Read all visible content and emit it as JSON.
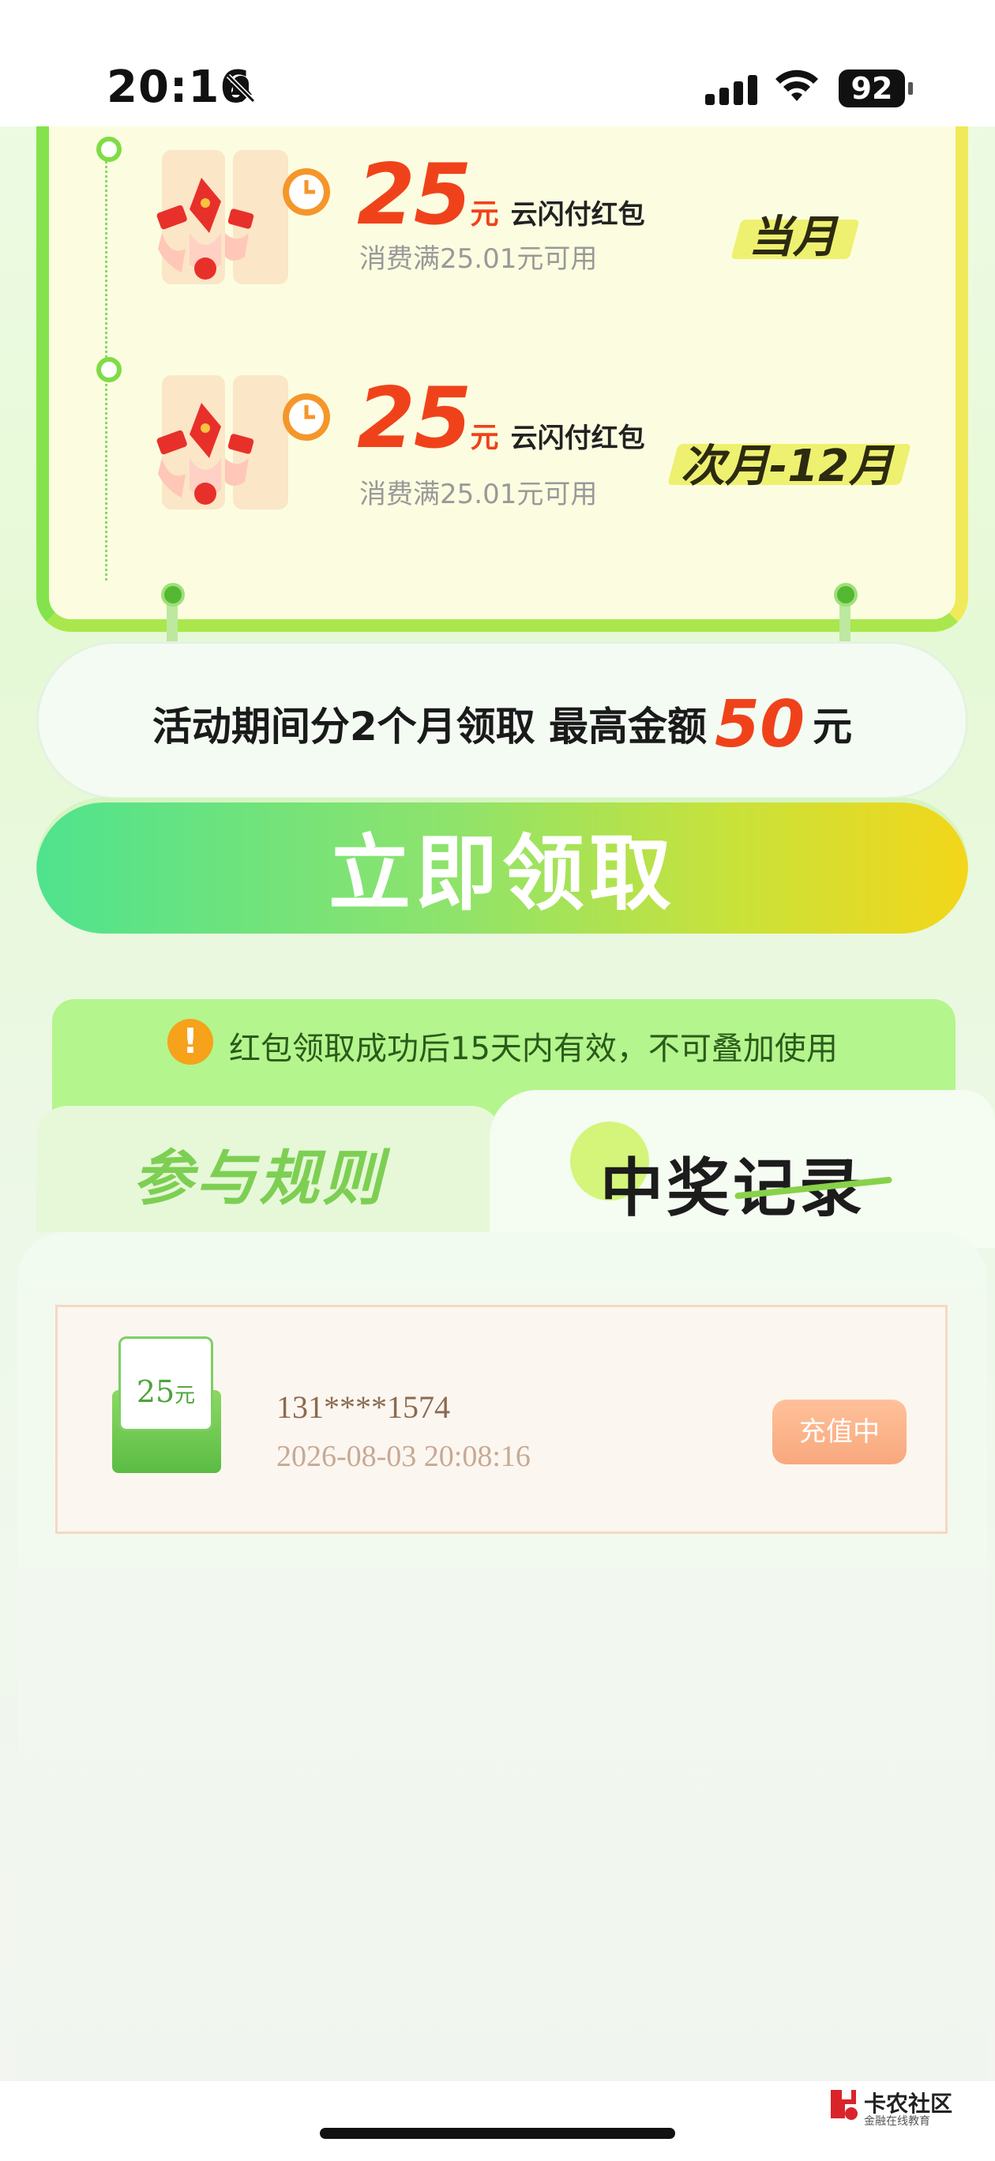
{
  "status_bar": {
    "time": "20:16",
    "battery": "92"
  },
  "coupons": [
    {
      "amount": "25",
      "unit": "元",
      "type": "云闪付红包",
      "condition": "消费满25.01元可用",
      "period": "当月"
    },
    {
      "amount": "25",
      "unit": "元",
      "type": "云闪付红包",
      "condition": "消费满25.01元可用",
      "period": "次月-12月"
    }
  ],
  "banner": {
    "prefix": "活动期间分2个月领取  最高金额",
    "max": "50",
    "suffix": "元"
  },
  "claim_button": "立即领取",
  "notice": {
    "icon": "!",
    "text": "红包领取成功后15天内有效，不可叠加使用"
  },
  "tabs": {
    "rules": "参与规则",
    "records": "中奖记录"
  },
  "records": [
    {
      "ticket_amount": "25",
      "ticket_unit": "元",
      "phone": "131****1574",
      "time": "2026-08-03 20:08:16",
      "status": "充值中"
    }
  ],
  "watermark": {
    "name": "卡农社区",
    "slogan": "金融在线教育"
  }
}
